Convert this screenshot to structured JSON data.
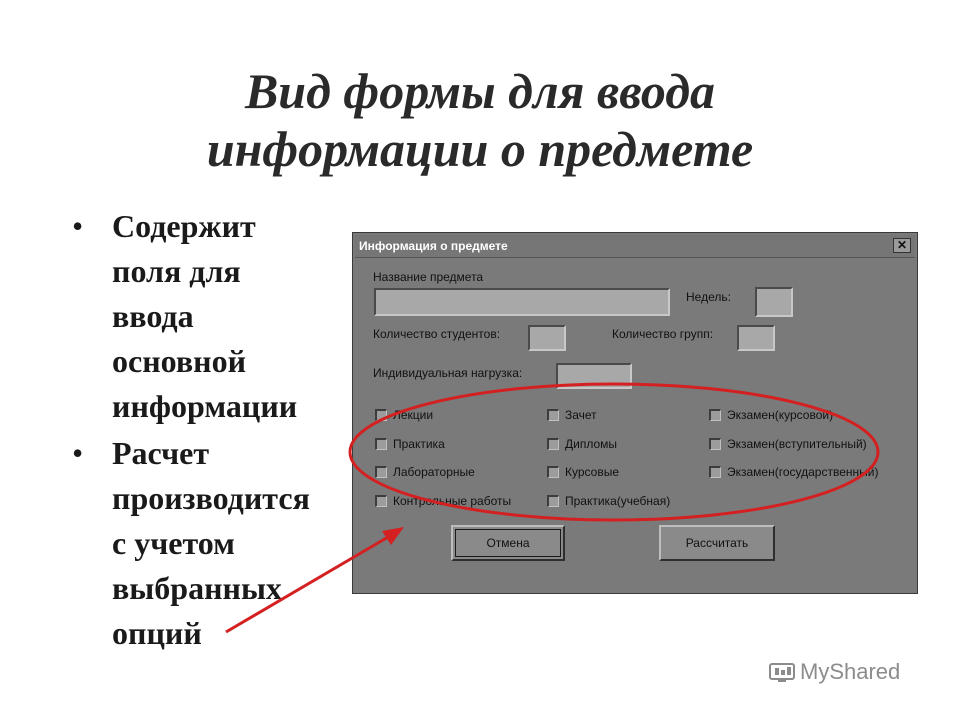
{
  "slide": {
    "title_line1": "Вид формы для ввода",
    "title_line2": "информации о предмете",
    "bullets": [
      {
        "lines": [
          "Содержит",
          "поля для",
          "ввода",
          "основной",
          "информации"
        ]
      },
      {
        "lines": [
          "Расчет",
          "производится",
          "с учетом",
          "выбранных",
          "опций"
        ]
      }
    ],
    "bullet_symbol": "•"
  },
  "dialog": {
    "title": "Информация о предмете",
    "close_label": "✕",
    "subject_name_label": "Название предмета",
    "weeks_label": "Недель:",
    "students_label": "Количество студентов:",
    "groups_label": "Количество групп:",
    "individual_load_label": "Индивидуальная нагрузка:",
    "checkboxes": [
      "Лекции",
      "Зачет",
      "Экзамен(курсовой)",
      "Практика",
      "Дипломы",
      "Экзамен(вступительный)",
      "Лабораторные",
      "Курсовые",
      "Экзамен(государственный)",
      "Контрольные работы",
      "Практика(учебная)"
    ],
    "cancel_label": "Отмена",
    "calculate_label": "Рассчитать"
  },
  "watermark": {
    "text": "MyShared"
  },
  "colors": {
    "annotation": "#d42020",
    "dialog_bg": "#7a7a7a"
  }
}
